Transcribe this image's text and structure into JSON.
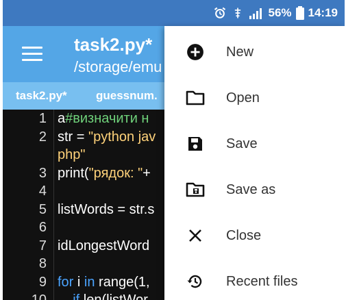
{
  "status_bar": {
    "battery_percent": "56%",
    "time": "14:19"
  },
  "app_bar": {
    "title": "task2.py*",
    "subtitle": "/storage/emu"
  },
  "tabs": [
    {
      "label": "task2.py*"
    },
    {
      "label": "guessnum."
    }
  ],
  "editor": {
    "line_numbers": [
      "1",
      "2",
      "",
      "3",
      "4",
      "5",
      "6",
      "7",
      "8",
      "9",
      "10"
    ],
    "lines": [
      {
        "parts": [
          {
            "t": "a",
            "c": ""
          },
          {
            "t": "#визначити н",
            "c": "cm"
          }
        ]
      },
      {
        "parts": [
          {
            "t": "str = ",
            "c": ""
          },
          {
            "t": "\"python jav",
            "c": "str"
          }
        ]
      },
      {
        "parts": [
          {
            "t": "php\"",
            "c": "str"
          }
        ]
      },
      {
        "parts": [
          {
            "t": "print(",
            "c": ""
          },
          {
            "t": "\"рядок: \"",
            "c": "str"
          },
          {
            "t": "+",
            "c": ""
          }
        ]
      },
      {
        "parts": []
      },
      {
        "parts": [
          {
            "t": "listWords = str.s",
            "c": ""
          }
        ]
      },
      {
        "parts": []
      },
      {
        "parts": [
          {
            "t": "idLongestWord",
            "c": ""
          }
        ]
      },
      {
        "parts": []
      },
      {
        "parts": [
          {
            "t": "for",
            "c": "kw"
          },
          {
            "t": " i ",
            "c": ""
          },
          {
            "t": "in",
            "c": "kw"
          },
          {
            "t": " range(1,",
            "c": ""
          }
        ]
      },
      {
        "parts": [
          {
            "t": "    if",
            "c": "kw"
          },
          {
            "t": " len(listWor",
            "c": ""
          }
        ]
      }
    ]
  },
  "menu": {
    "items": [
      {
        "label": "New",
        "icon": "plus-circle-icon"
      },
      {
        "label": "Open",
        "icon": "folder-icon"
      },
      {
        "label": "Save",
        "icon": "floppy-disk-icon"
      },
      {
        "label": "Save as",
        "icon": "folder-save-as-icon"
      },
      {
        "label": "Close",
        "icon": "close-icon"
      },
      {
        "label": "Recent files",
        "icon": "history-icon"
      }
    ]
  },
  "colors": {
    "status_bar": "#3e79c0",
    "app_bar": "#54a6e6",
    "tab_bar": "#78bff0",
    "editor_bg": "#111111",
    "keyword": "#4aa3ff",
    "string": "#ffd27a",
    "comment": "#6fd07a"
  }
}
